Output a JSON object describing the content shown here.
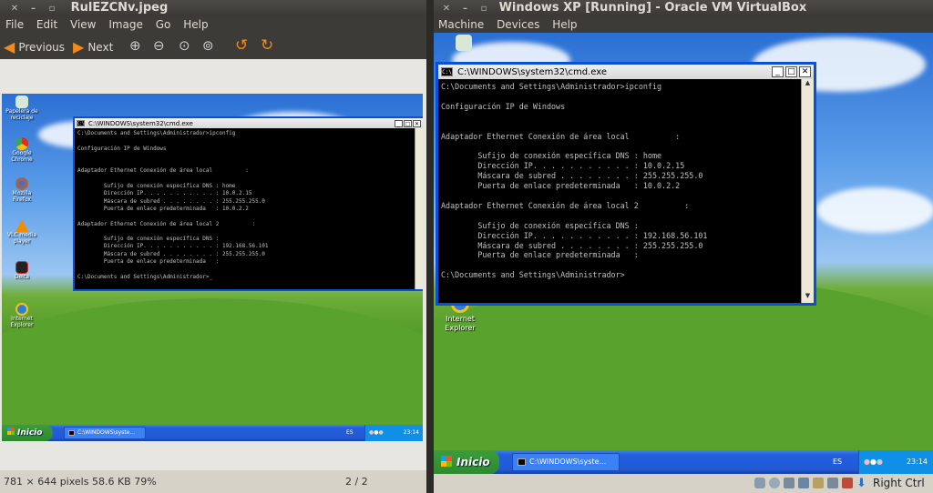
{
  "left": {
    "title": "RulEZCNv.jpeg",
    "menu": [
      "File",
      "Edit",
      "View",
      "Image",
      "Go",
      "Help"
    ],
    "toolbar": {
      "previous": "Previous",
      "next": "Next"
    },
    "status": {
      "info": "781 × 644 pixels  58.6 KB   79%",
      "page": "2 / 2"
    },
    "desktop_icons": [
      "Papelera de reciclaje",
      "Google Chrome",
      "Mozilla Firefox",
      "VLC media player",
      "Delta",
      "Internet Explorer"
    ],
    "cmd": {
      "title": "C:\\WINDOWS\\system32\\cmd.exe",
      "lines": "C:\\Documents and Settings\\Administrador>ipconfig\n\nConfiguración IP de Windows\n\n\nAdaptador Ethernet Conexión de área local          :\n\n        Sufijo de conexión específica DNS : home\n        Dirección IP. . . . . . . . . . . : 10.0.2.15\n        Máscara de subred . . . . . . . . : 255.255.255.0\n        Puerta de enlace predeterminada   : 10.0.2.2\n\nAdaptador Ethernet Conexión de área local 2          :\n\n        Sufijo de conexión específica DNS :\n        Dirección IP. . . . . . . . . . . : 192.168.56.101\n        Máscara de subred . . . . . . . . : 255.255.255.0\n        Puerta de enlace predeterminada   :\n\nC:\\Documents and Settings\\Administrador>_"
    },
    "taskbar": {
      "start": "Inicio",
      "task": "C:\\WINDOWS\\syste...",
      "lang": "ES",
      "clock": "23:14"
    }
  },
  "right": {
    "title": "Windows XP [Running] - Oracle VM VirtualBox",
    "menu": [
      "Machine",
      "Devices",
      "Help"
    ],
    "desktop_icons": [
      "Internet Explorer"
    ],
    "cmd": {
      "title": "C:\\WINDOWS\\system32\\cmd.exe",
      "lines": "C:\\Documents and Settings\\Administrador>ipconfig\n\nConfiguración IP de Windows\n\n\nAdaptador Ethernet Conexión de área local          :\n\n        Sufijo de conexión específica DNS : home\n        Dirección IP. . . . . . . . . . . : 10.0.2.15\n        Máscara de subred . . . . . . . . : 255.255.255.0\n        Puerta de enlace predeterminada   : 10.0.2.2\n\nAdaptador Ethernet Conexión de área local 2          :\n\n        Sufijo de conexión específica DNS :\n        Dirección IP. . . . . . . . . . . : 192.168.56.101\n        Máscara de subred . . . . . . . . : 255.255.255.0\n        Puerta de enlace predeterminada   :\n\nC:\\Documents and Settings\\Administrador>"
    },
    "taskbar": {
      "start": "Inicio",
      "task": "C:\\WINDOWS\\syste...",
      "lang": "ES",
      "clock": "23:14"
    },
    "status": {
      "host_key": "Right Ctrl"
    }
  }
}
